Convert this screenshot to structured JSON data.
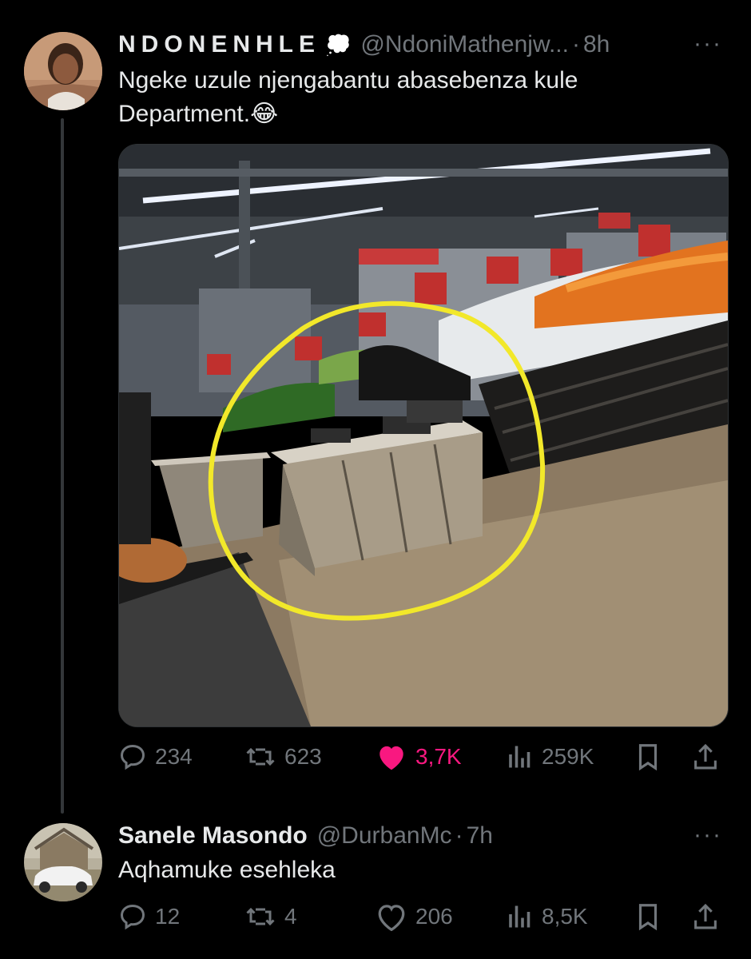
{
  "tweets": [
    {
      "display_name": "NDONENHLE",
      "badge": "💭",
      "handle": "@NdoniMathenjw...",
      "dot": "·",
      "time": "8h",
      "more": "···",
      "text_line1": "Ngeke uzule njengabantu abasebenza kule",
      "text_line2": "Department.😂",
      "actions": {
        "replies": "234",
        "retweets": "623",
        "likes": "3,7K",
        "views": "259K"
      },
      "liked": true
    },
    {
      "display_name": "Sanele Masondo",
      "handle": "@DurbanMc",
      "dot": "·",
      "time": "7h",
      "more": "···",
      "text_line1": "Aqhamuke esehleka",
      "actions": {
        "replies": "12",
        "retweets": "4",
        "likes": "206",
        "views": "8,5K"
      },
      "liked": false
    }
  ],
  "colors": {
    "background": "#000000",
    "text": "#e7e9ea",
    "muted": "#71767b",
    "like_active": "#f91880",
    "annotation_circle": "#f2e82a"
  },
  "icons": [
    "reply-icon",
    "retweet-icon",
    "like-icon",
    "views-icon",
    "bookmark-icon",
    "share-icon",
    "more-icon"
  ]
}
